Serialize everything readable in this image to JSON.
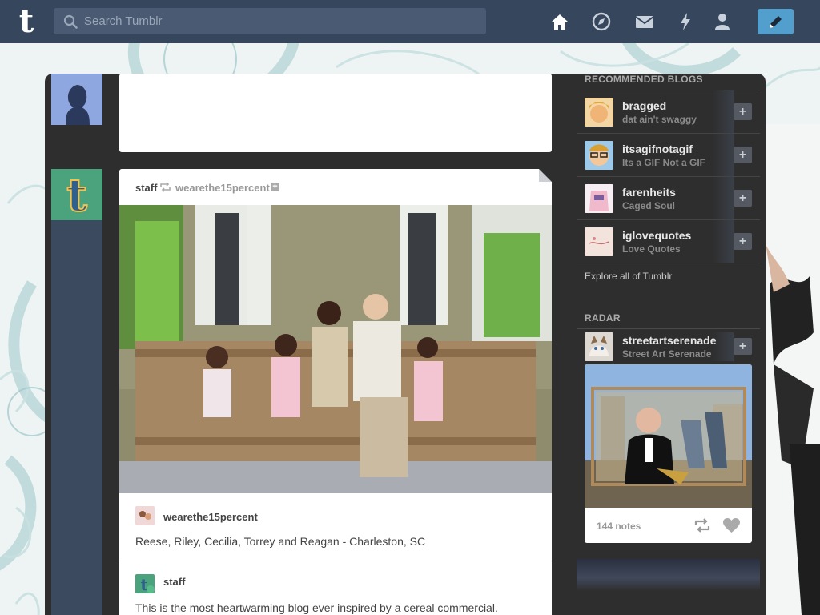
{
  "topbar": {
    "search_placeholder": "Search Tumblr",
    "logo_letter": "t",
    "icons": [
      "home-icon",
      "explore-icon",
      "inbox-icon",
      "activity-icon",
      "account-icon",
      "compose-icon"
    ]
  },
  "post1": {
    "avatar": "silhouette"
  },
  "post2": {
    "author": "staff",
    "reblogged_from": "wearethe15percent",
    "caption_user": "wearethe15percent",
    "caption": "Reese, Riley, Cecilia, Torrey and Reagan - Charleston, SC",
    "reblog_user": "staff",
    "body": "This is the most heartwarming blog ever inspired by a cereal commercial."
  },
  "sidebar": {
    "recommended_title": "RECOMMENDED BLOGS",
    "blogs": [
      {
        "name": "bragged",
        "subtitle": "dat ain't swaggy"
      },
      {
        "name": "itsagifnotagif",
        "subtitle": "Its a GIF Not a GIF"
      },
      {
        "name": "farenheits",
        "subtitle": "Caged Soul"
      },
      {
        "name": "iglovequotes",
        "subtitle": "Love Quotes"
      }
    ],
    "follow_label": "+",
    "explore_label": "Explore all of Tumblr",
    "radar_title": "RADAR",
    "radar_blog": {
      "name": "streetartserenade",
      "subtitle": "Street Art Serenade"
    },
    "radar_notes": "144 notes"
  },
  "colors": {
    "topbar": "#36465d",
    "search_bg": "#4a5a72",
    "compose": "#529ecc",
    "dashboard": "#2e2e2e",
    "card": "#ffffff"
  }
}
